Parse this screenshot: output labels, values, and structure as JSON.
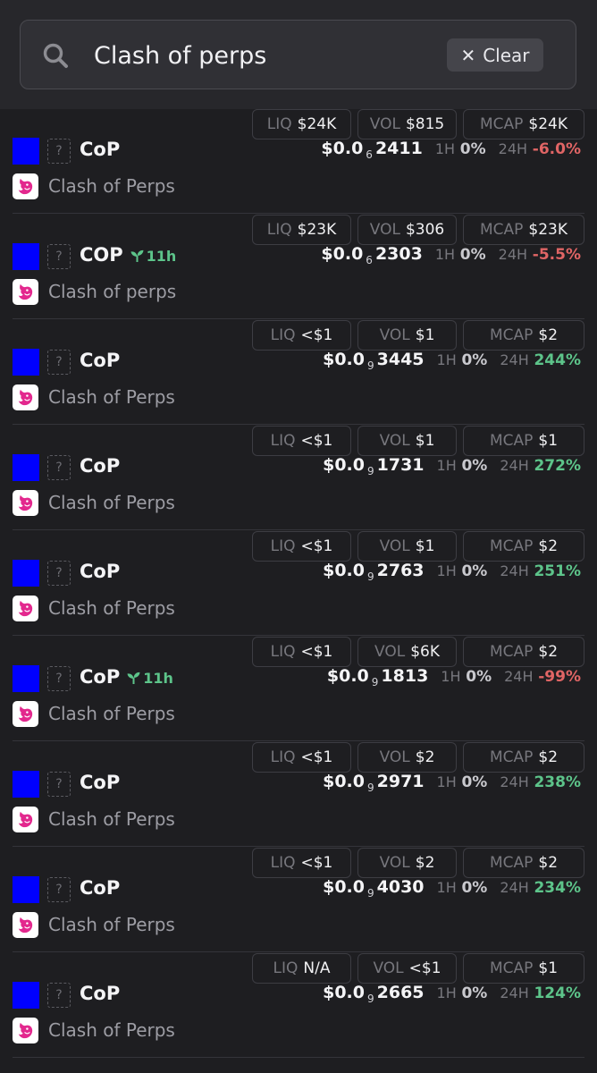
{
  "search": {
    "value": "Clash of perps",
    "clear_label": "Clear"
  },
  "labels": {
    "h1": "1H",
    "h24": "24H",
    "liq": "LIQ",
    "vol": "VOL",
    "mcap": "MCAP"
  },
  "colors": {
    "chain": "#0000ff",
    "positive": "#5dc48a",
    "negative": "#e06565"
  },
  "rows": [
    {
      "symbol": "CoP",
      "age": "",
      "name": "Clash of Perps",
      "price_prefix": "$0.0",
      "price_zeros": "6",
      "price_digits": "2411",
      "change_1h": "0%",
      "change_24h": "-6.0%",
      "trend": "negative",
      "liq": "$24K",
      "vol": "$815",
      "mcap": "$24K"
    },
    {
      "symbol": "COP",
      "age": "11h",
      "name": "Clash of perps",
      "price_prefix": "$0.0",
      "price_zeros": "6",
      "price_digits": "2303",
      "change_1h": "0%",
      "change_24h": "-5.5%",
      "trend": "negative",
      "liq": "$23K",
      "vol": "$306",
      "mcap": "$23K"
    },
    {
      "symbol": "CoP",
      "age": "",
      "name": "Clash of Perps",
      "price_prefix": "$0.0",
      "price_zeros": "9",
      "price_digits": "3445",
      "change_1h": "0%",
      "change_24h": "244%",
      "trend": "positive",
      "liq": "<$1",
      "vol": "$1",
      "mcap": "$2"
    },
    {
      "symbol": "CoP",
      "age": "",
      "name": "Clash of Perps",
      "price_prefix": "$0.0",
      "price_zeros": "9",
      "price_digits": "1731",
      "change_1h": "0%",
      "change_24h": "272%",
      "trend": "positive",
      "liq": "<$1",
      "vol": "$1",
      "mcap": "$1"
    },
    {
      "symbol": "CoP",
      "age": "",
      "name": "Clash of Perps",
      "price_prefix": "$0.0",
      "price_zeros": "9",
      "price_digits": "2763",
      "change_1h": "0%",
      "change_24h": "251%",
      "trend": "positive",
      "liq": "<$1",
      "vol": "$1",
      "mcap": "$2"
    },
    {
      "symbol": "CoP",
      "age": "11h",
      "name": "Clash of Perps",
      "price_prefix": "$0.0",
      "price_zeros": "9",
      "price_digits": "1813",
      "change_1h": "0%",
      "change_24h": "-99%",
      "trend": "negative",
      "liq": "<$1",
      "vol": "$6K",
      "mcap": "$2"
    },
    {
      "symbol": "CoP",
      "age": "",
      "name": "Clash of Perps",
      "price_prefix": "$0.0",
      "price_zeros": "9",
      "price_digits": "2971",
      "change_1h": "0%",
      "change_24h": "238%",
      "trend": "positive",
      "liq": "<$1",
      "vol": "$2",
      "mcap": "$2"
    },
    {
      "symbol": "CoP",
      "age": "",
      "name": "Clash of Perps",
      "price_prefix": "$0.0",
      "price_zeros": "9",
      "price_digits": "4030",
      "change_1h": "0%",
      "change_24h": "234%",
      "trend": "positive",
      "liq": "<$1",
      "vol": "$2",
      "mcap": "$2"
    },
    {
      "symbol": "CoP",
      "age": "",
      "name": "Clash of Perps",
      "price_prefix": "$0.0",
      "price_zeros": "9",
      "price_digits": "2665",
      "change_1h": "0%",
      "change_24h": "124%",
      "trend": "positive",
      "liq": "N/A",
      "vol": "<$1",
      "mcap": "$1"
    }
  ]
}
